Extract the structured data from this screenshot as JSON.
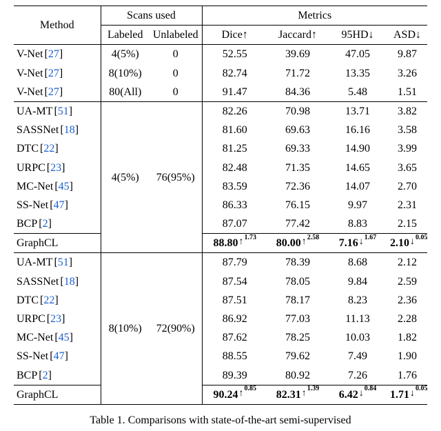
{
  "header": {
    "method": "Method",
    "scans_used": "Scans used",
    "labeled": "Labeled",
    "unlabeled": "Unlabeled",
    "metrics": "Metrics",
    "dice": "Dice↑",
    "jaccard": "Jaccard↑",
    "hd": "95HD↓",
    "asd": "ASD↓"
  },
  "methods": {
    "vnet": {
      "name": "V-Net",
      "cite": "27"
    },
    "uamt": {
      "name": "UA-MT",
      "cite": "51"
    },
    "sassnet": {
      "name": "SASSNet",
      "cite": "18"
    },
    "dtc": {
      "name": "DTC",
      "cite": "22"
    },
    "urpc": {
      "name": "URPC",
      "cite": "23"
    },
    "mcnet": {
      "name": "MC-Net",
      "cite": "45"
    },
    "ssnet": {
      "name": "SS-Net",
      "cite": "47"
    },
    "bcp": {
      "name": "BCP",
      "cite": "2"
    },
    "graphcl": {
      "name": "GraphCL"
    }
  },
  "scan_settings": {
    "s5": {
      "labeled": "4(5%)",
      "unlabeled": "0"
    },
    "s10": {
      "labeled": "8(10%)",
      "unlabeled": "0"
    },
    "sall": {
      "labeled": "80(All)",
      "unlabeled": "0"
    },
    "ss5": {
      "labeled": "4(5%)",
      "unlabeled": "76(95%)"
    },
    "ss10": {
      "labeled": "8(10%)",
      "unlabeled": "72(90%)"
    }
  },
  "rows_top": [
    {
      "method_key": "vnet",
      "setting_key": "s5",
      "dice": "52.55",
      "jacc": "39.69",
      "hd": "47.05",
      "asd": "9.87"
    },
    {
      "method_key": "vnet",
      "setting_key": "s10",
      "dice": "82.74",
      "jacc": "71.72",
      "hd": "13.35",
      "asd": "3.26"
    },
    {
      "method_key": "vnet",
      "setting_key": "sall",
      "dice": "91.47",
      "jacc": "84.36",
      "hd": "5.48",
      "asd": "1.51"
    }
  ],
  "group_a": {
    "setting_key": "ss5",
    "rows": [
      {
        "method_key": "uamt",
        "dice": "82.26",
        "jacc": "70.98",
        "hd": "13.71",
        "asd": "3.82"
      },
      {
        "method_key": "sassnet",
        "dice": "81.60",
        "jacc": "69.63",
        "hd": "16.16",
        "asd": "3.58"
      },
      {
        "method_key": "dtc",
        "dice": "81.25",
        "jacc": "69.33",
        "hd": "14.90",
        "asd": "3.99"
      },
      {
        "method_key": "urpc",
        "dice": "82.48",
        "jacc": "71.35",
        "hd": "14.65",
        "asd": "3.65"
      },
      {
        "method_key": "mcnet",
        "dice": "83.59",
        "jacc": "72.36",
        "hd": "14.07",
        "asd": "2.70"
      },
      {
        "method_key": "ssnet",
        "dice": "86.33",
        "jacc": "76.15",
        "hd": "9.97",
        "asd": "2.31"
      },
      {
        "method_key": "bcp",
        "dice": "87.07",
        "jacc": "77.42",
        "hd": "8.83",
        "asd": "2.15"
      }
    ],
    "graphcl": {
      "dice": {
        "v": "88.80",
        "d": "1.73",
        "dir": "up"
      },
      "jacc": {
        "v": "80.00",
        "d": "2.58",
        "dir": "up"
      },
      "hd": {
        "v": "7.16",
        "d": "1.67",
        "dir": "down"
      },
      "asd": {
        "v": "2.10",
        "d": "0.05",
        "dir": "down"
      }
    }
  },
  "group_b": {
    "setting_key": "ss10",
    "rows": [
      {
        "method_key": "uamt",
        "dice": "87.79",
        "jacc": "78.39",
        "hd": "8.68",
        "asd": "2.12"
      },
      {
        "method_key": "sassnet",
        "dice": "87.54",
        "jacc": "78.05",
        "hd": "9.84",
        "asd": "2.59"
      },
      {
        "method_key": "dtc",
        "dice": "87.51",
        "jacc": "78.17",
        "hd": "8.23",
        "asd": "2.36"
      },
      {
        "method_key": "urpc",
        "dice": "86.92",
        "jacc": "77.03",
        "hd": "11.13",
        "asd": "2.28"
      },
      {
        "method_key": "mcnet",
        "dice": "87.62",
        "jacc": "78.25",
        "hd": "10.03",
        "asd": "1.82"
      },
      {
        "method_key": "ssnet",
        "dice": "88.55",
        "jacc": "79.62",
        "hd": "7.49",
        "asd": "1.90"
      },
      {
        "method_key": "bcp",
        "dice": "89.39",
        "jacc": "80.92",
        "hd": "7.26",
        "asd": "1.76"
      }
    ],
    "graphcl": {
      "dice": {
        "v": "90.24",
        "d": "0.85",
        "dir": "up"
      },
      "jacc": {
        "v": "82.31",
        "d": "1.39",
        "dir": "up"
      },
      "hd": {
        "v": "6.42",
        "d": "0.84",
        "dir": "down"
      },
      "asd": {
        "v": "1.71",
        "d": "0.05",
        "dir": "down"
      }
    }
  },
  "arrows": {
    "up": "↑",
    "down": "↓"
  },
  "caption_prefix": "Table 1. ",
  "caption_text": "Comparisons with state-of-the-art semi-supervised"
}
